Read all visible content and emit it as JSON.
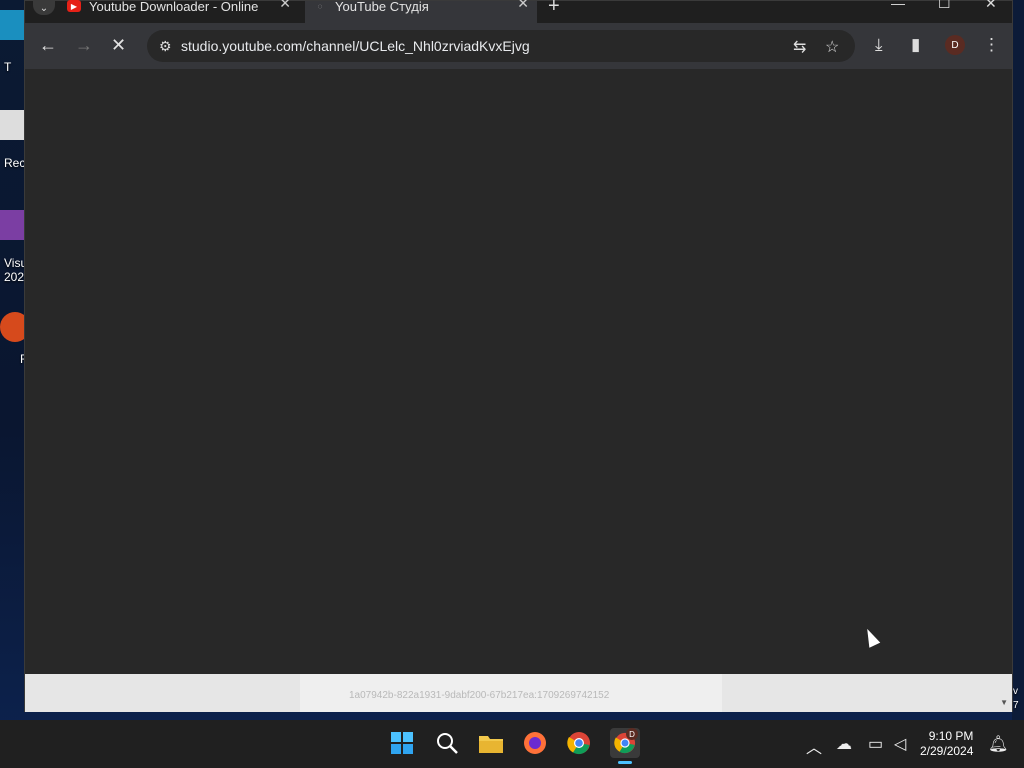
{
  "desktop": {
    "labels": [
      "T",
      "Rec",
      "Visu",
      "202",
      "F"
    ],
    "corner_text": [
      "v",
      "7"
    ]
  },
  "browser": {
    "tabs": [
      {
        "title": "Youtube Downloader - Online Y",
        "active": false
      },
      {
        "title": "YouTube Студія",
        "active": true
      }
    ],
    "new_tab_label": "+",
    "omnibox": {
      "url": "studio.youtube.com/channel/UCLelc_Nhl0zrviadKvxEjvg"
    },
    "avatar_letter": "D",
    "status_text": "1a07942b-822a1931-9dabf200-67b217ea:1709269742152"
  },
  "taskbar": {
    "clock": {
      "time": "9:10 PM",
      "date": "2/29/2024"
    },
    "chrome_badge": "D"
  },
  "colors": {
    "window_bg": "#202124",
    "content_bg": "#282828",
    "toolbar_bg": "#35363a",
    "taskbar_bg": "#202020"
  }
}
